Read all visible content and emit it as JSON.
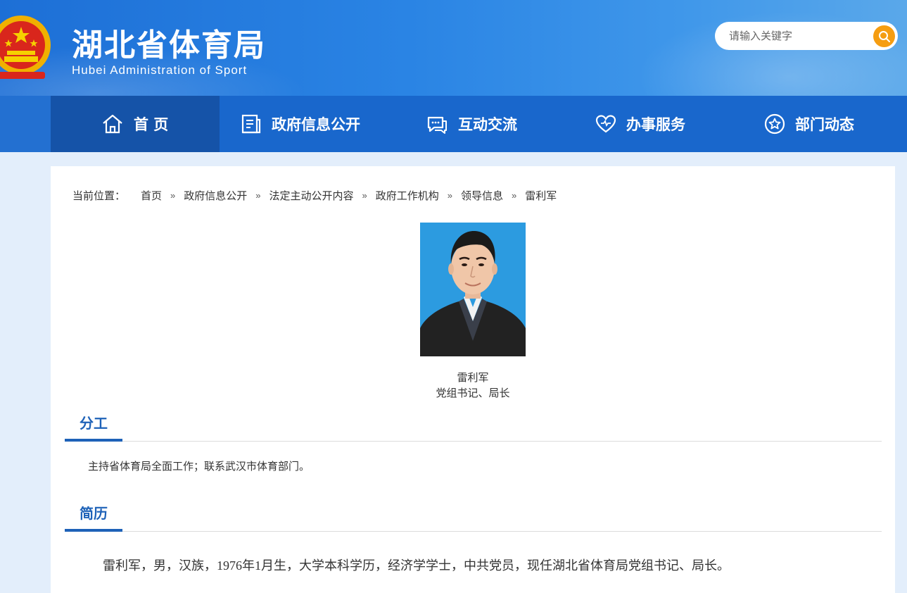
{
  "header": {
    "title": "湖北省体育局",
    "subtitle": "Hubei Administration of Sport",
    "search": {
      "placeholder": "请输入关键字",
      "icon": "search-icon"
    }
  },
  "nav": {
    "items": [
      {
        "label": "首 页",
        "icon": "home-icon",
        "active": true
      },
      {
        "label": "政府信息公开",
        "icon": "document-icon"
      },
      {
        "label": "互动交流",
        "icon": "chat-icon"
      },
      {
        "label": "办事服务",
        "icon": "heart-icon"
      },
      {
        "label": "部门动态",
        "icon": "star-icon"
      }
    ]
  },
  "breadcrumb": {
    "label": "当前位置：",
    "items": [
      "首页",
      "政府信息公开",
      "法定主动公开内容",
      "政府工作机构",
      "领导信息",
      "雷利军"
    ],
    "separator": "»"
  },
  "profile": {
    "name": "雷利军",
    "position": "党组书记、局长"
  },
  "sections": {
    "duty_heading": "分工",
    "duty_text": "主持省体育局全面工作；联系武汉市体育部门。",
    "bio_heading": "简历",
    "bio_text": "雷利军，男，汉族，1976年1月生，大学本科学历，经济学学士，中共党员，现任湖北省体育局党组书记、局长。"
  },
  "colors": {
    "nav_bg": "#1967cc",
    "nav_active": "#1553a8",
    "accent": "#1e62b8",
    "search_button": "#f59d11"
  }
}
